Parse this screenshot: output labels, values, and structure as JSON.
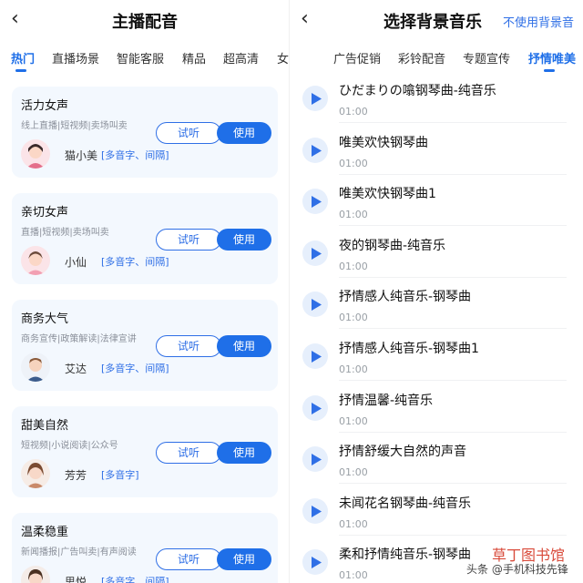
{
  "left": {
    "title": "主播配音",
    "tabs": [
      "热门",
      "直播场景",
      "智能客服",
      "精品",
      "超高清",
      "女祝福"
    ],
    "voices": [
      {
        "name": "活力女声",
        "tags": "线上直播|短视频|卖场叫卖",
        "person": "猫小美",
        "feature": "[多音字、间隔]",
        "try": "试听",
        "use": "使用"
      },
      {
        "name": "亲切女声",
        "tags": "直播|短视频|卖场叫卖",
        "person": "小仙",
        "feature": "[多音字、间隔]",
        "try": "试听",
        "use": "使用"
      },
      {
        "name": "商务大气",
        "tags": "商务宣传|政策解读|法律宣讲",
        "person": "艾达",
        "feature": "[多音字、间隔]",
        "try": "试听",
        "use": "使用"
      },
      {
        "name": "甜美自然",
        "tags": "短视频|小说阅读|公众号",
        "person": "芳芳",
        "feature": "[多音字]",
        "try": "试听",
        "use": "使用"
      },
      {
        "name": "温柔稳重",
        "tags": "新闻播报|广告叫卖|有声阅读",
        "person": "思悦",
        "feature": "[多音字、间隔]",
        "try": "试听",
        "use": "使用"
      }
    ]
  },
  "right": {
    "title": "选择背景音乐",
    "action": "不使用背景音",
    "tabs": [
      "广告促销",
      "彩铃配音",
      "专题宣传",
      "抒情唯美"
    ],
    "tracks": [
      {
        "title": "ひだまりの噏钢琴曲-纯音乐",
        "duration": "01:00"
      },
      {
        "title": "唯美欢快钢琴曲",
        "duration": "01:00"
      },
      {
        "title": "唯美欢快钢琴曲1",
        "duration": "01:00"
      },
      {
        "title": "夜的钢琴曲-纯音乐",
        "duration": "01:00"
      },
      {
        "title": "抒情感人纯音乐-钢琴曲",
        "duration": "01:00"
      },
      {
        "title": "抒情感人纯音乐-钢琴曲1",
        "duration": "01:00"
      },
      {
        "title": "抒情温馨-纯音乐",
        "duration": "01:00"
      },
      {
        "title": "抒情舒缓大自然的声音",
        "duration": "01:00"
      },
      {
        "title": "未闻花名钢琴曲-纯音乐",
        "duration": "01:00"
      },
      {
        "title": "柔和抒情纯音乐-钢琴曲",
        "duration": "01:00"
      }
    ]
  },
  "watermark": {
    "main": "草丁图书馆",
    "sub": "头条 @手机科技先锋"
  },
  "colors": {
    "accent": "#1f6fe8",
    "card": "#f3f8fe",
    "tag": "#2f6fe6"
  }
}
